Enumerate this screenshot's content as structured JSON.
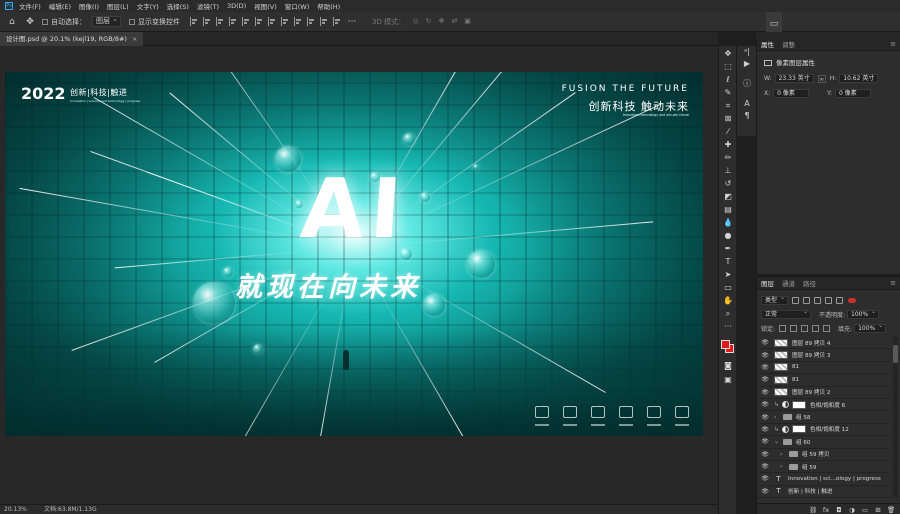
{
  "menu": [
    "文件(F)",
    "编辑(E)",
    "图像(I)",
    "图层(L)",
    "文字(Y)",
    "选择(S)",
    "滤镜(T)",
    "3D(D)",
    "视图(V)",
    "窗口(W)",
    "帮助(H)"
  ],
  "options": {
    "auto_select_label": "自动选择：",
    "auto_select_value": "图层",
    "show_transform_label": "显示变换控件",
    "mode_3d_label": "3D 模式："
  },
  "document": {
    "tab_title": "设计图.psd @ 20.1% (kejl19, RGB/8#)"
  },
  "poster": {
    "year": "2022",
    "year_subtitle": "创新|科技|触进",
    "year_tiny": "Innovation | science and technology | progress",
    "fusion": "FUSION THE FUTURE",
    "slogan": "创新科技  触动未来",
    "slogan_sub": "Innovative technology and win-win future",
    "ai": "AI",
    "headline": "就现在向未来"
  },
  "status": {
    "zoom": "20.13%",
    "doc_info": "文档:63.8M/1.13G"
  },
  "properties": {
    "tab_properties": "属性",
    "tab_adjust": "调整",
    "title": "像素图层属性",
    "w_label": "W:",
    "w_value": "23.33 英寸",
    "h_label": "H:",
    "h_value": "10.62 英寸",
    "x_label": "X:",
    "x_value": "0 像素",
    "y_label": "Y:",
    "y_value": "0 像素"
  },
  "layers": {
    "tab_layers": "图层",
    "tab_channels": "通道",
    "tab_paths": "路径",
    "filter_kind": "类型",
    "blend_mode": "正常",
    "opacity_label": "不透明度:",
    "opacity_value": "100%",
    "lock_label": "锁定:",
    "fill_label": "填充:",
    "fill_value": "100%",
    "items": [
      {
        "name": "图层 89 拷贝 4",
        "kind": "pixel"
      },
      {
        "name": "图层 89 拷贝 3",
        "kind": "pixel"
      },
      {
        "name": "81",
        "kind": "pixel"
      },
      {
        "name": "81",
        "kind": "pixel"
      },
      {
        "name": "图层 89 拷贝 2",
        "kind": "pixel"
      },
      {
        "name": "色相/饱和度 6",
        "kind": "adjustment"
      },
      {
        "name": "组 58",
        "kind": "group"
      },
      {
        "name": "色相/饱和度 12",
        "kind": "adjustment"
      },
      {
        "name": "组 60",
        "kind": "group-open"
      },
      {
        "name": "组 59 拷贝",
        "kind": "group-nested"
      },
      {
        "name": "组 59",
        "kind": "group-nested"
      },
      {
        "name": "Innovation | sci...ology | progress",
        "kind": "text"
      },
      {
        "name": "创新 | 科技 | 触进",
        "kind": "text"
      }
    ]
  },
  "colors": {
    "foreground": "#e01a1a",
    "background": "#e01a1a",
    "accent": "#31a8ff",
    "poster_teal": "#17b8b2"
  }
}
